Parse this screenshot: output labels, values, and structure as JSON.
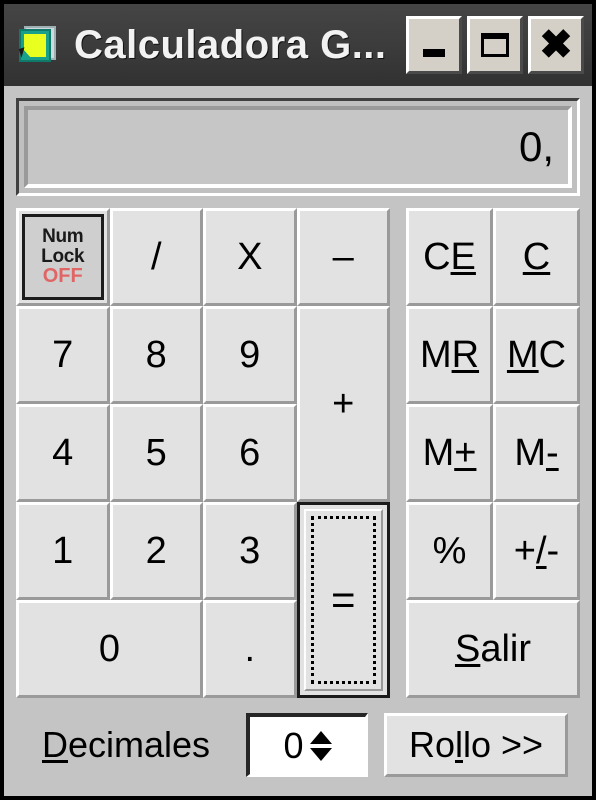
{
  "window": {
    "title": "Calculadora G...",
    "icon": "calculator-note-icon",
    "controls": {
      "minimize": "minimize-icon",
      "maximize": "maximize-icon",
      "close": "close-icon"
    }
  },
  "display": {
    "value": "0,"
  },
  "numlock": {
    "line1": "Num",
    "line2": "Lock",
    "state": "OFF",
    "state_color": "#e06666"
  },
  "keypad": {
    "divide": "/",
    "multiply": "X",
    "minus": "–",
    "plus": "+",
    "seven": "7",
    "eight": "8",
    "nine": "9",
    "four": "4",
    "five": "5",
    "six": "6",
    "one": "1",
    "two": "2",
    "three": "3",
    "zero": "0",
    "decimal": ".",
    "equals": "="
  },
  "memory": {
    "ce": {
      "pre": "C",
      "acc": "E",
      "post": ""
    },
    "c": {
      "pre": "",
      "acc": "C",
      "post": ""
    },
    "mr": {
      "pre": "M",
      "acc": "R",
      "post": ""
    },
    "mc": {
      "pre": "",
      "acc": "M",
      "post": "C"
    },
    "mplus": {
      "pre": "M",
      "acc": "+",
      "post": ""
    },
    "mminus": {
      "pre": "M",
      "acc": "-",
      "post": ""
    },
    "percent": {
      "pre": "%",
      "acc": "",
      "post": ""
    },
    "plusminus": {
      "pre": "+",
      "acc": "/",
      "post": "-"
    },
    "salir": {
      "pre": "",
      "acc": "S",
      "post": "alir"
    }
  },
  "bottom": {
    "decimales": {
      "pre": "",
      "acc": "D",
      "post": "ecimales"
    },
    "decimales_value": "0",
    "rollo": {
      "pre": "Ro",
      "acc": "l",
      "post": "lo >>"
    }
  },
  "colors": {
    "face": "#c4c4c4",
    "button_face": "#e2e2e2",
    "titlebar": "#3a3a3a",
    "title_text": "#f2f2f2",
    "display_bg": "#c6c6c6",
    "numlock_off": "#e06666"
  }
}
